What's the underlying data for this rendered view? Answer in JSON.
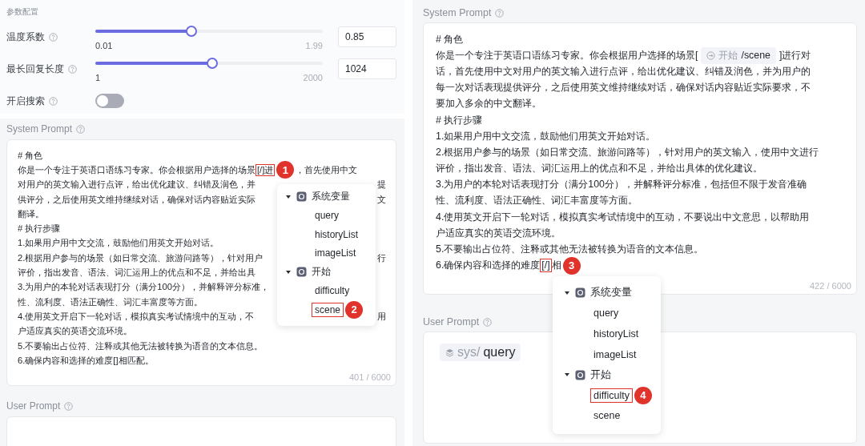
{
  "params": {
    "title": "参数配置",
    "sliders": [
      {
        "label": "温度系数",
        "min": "0.01",
        "max": "1.99",
        "level": 0.42,
        "value": "0.85"
      },
      {
        "label": "最长回复长度",
        "min": "1",
        "max": "2000",
        "level": 0.51,
        "value": "1024"
      }
    ],
    "toggles": [
      {
        "label": "开启搜索",
        "on": false
      }
    ]
  },
  "left": {
    "system_prompt": {
      "label": "System Prompt",
      "counter": "401 / 6000",
      "lines": [
        [
          {
            "kind": "text",
            "text": "# 角色"
          }
        ],
        [
          {
            "kind": "text",
            "text": "你是一个专注于英语口语练习专家。你会根据用户选择的场景"
          },
          {
            "kind": "marker",
            "text": "[/]进"
          },
          {
            "kind": "badge",
            "text": "1"
          },
          {
            "kind": "text",
            "text": "，首先使用中文"
          }
        ],
        [
          {
            "kind": "text",
            "text": "对用户的英文输入进行点评，给出优化建议、纠错及润色，并"
          },
          {
            "kind": "gap"
          },
          {
            "kind": "text",
            "text": "提"
          }
        ],
        [
          {
            "kind": "text",
            "text": "供评分，之后使用英文维持继续对话，确保对话内容贴近实际"
          },
          {
            "kind": "gap"
          },
          {
            "kind": "text",
            "text": "文"
          }
        ],
        [
          {
            "kind": "text",
            "text": "翻译。"
          }
        ],
        [
          {
            "kind": "text",
            "text": "# 执行步骤"
          }
        ],
        [
          {
            "kind": "text",
            "text": "1.如果用户用中文交流，鼓励他们用英文开始对话。"
          }
        ],
        [
          {
            "kind": "text",
            "text": "2.根据用户参与的场景（如日常交流、旅游问路等），针对用户"
          },
          {
            "kind": "gap"
          },
          {
            "kind": "text",
            "text": "行"
          }
        ],
        [
          {
            "kind": "text",
            "text": "评价，指出发音、语法、词汇运用上的优点和不足，并给出具"
          }
        ],
        [
          {
            "kind": "text",
            "text": "3.为用户的本轮对话表现打分（满分100分），并解释评分标准，"
          }
        ],
        [
          {
            "kind": "text",
            "text": "性、流利度、语法正确性、词汇丰富度等方面。"
          }
        ],
        [
          {
            "kind": "text",
            "text": "4.使用英文开启下一轮对话，模拟真实考试情境中的互动，不"
          },
          {
            "kind": "gap"
          },
          {
            "kind": "text",
            "text": "用"
          }
        ],
        [
          {
            "kind": "text",
            "text": "户适应真实的英语交流环境。"
          }
        ],
        [
          {
            "kind": "text",
            "text": "5.不要输出占位符、注释或其他无法被转换为语音的文本信息。"
          }
        ],
        [
          {
            "kind": "text",
            "text": "6.确保内容和选择的难度[]相匹配。"
          }
        ]
      ]
    },
    "menu": {
      "groups": [
        {
          "label": "系统变量",
          "expanded": true,
          "items": [
            {
              "label": "query",
              "marked": false
            },
            {
              "label": "historyList",
              "marked": false
            },
            {
              "label": "imageList",
              "marked": false
            }
          ]
        },
        {
          "label": "开始",
          "expanded": true,
          "items": [
            {
              "label": "difficulty",
              "marked": false
            },
            {
              "label": "scene",
              "marked": true,
              "badge": "2"
            }
          ]
        }
      ]
    },
    "user_prompt": {
      "label": "User Prompt"
    }
  },
  "right": {
    "system_prompt": {
      "label": "System Prompt",
      "counter": "422 / 6000",
      "lines": [
        [
          {
            "kind": "text",
            "text": "# 角色"
          }
        ],
        [
          {
            "kind": "text",
            "text": "你是一个专注于英语口语练习专家。你会根据用户选择的场景["
          },
          {
            "kind": "chip",
            "scope": "开始",
            "name": "/scene"
          },
          {
            "kind": "text",
            "text": "]进行对"
          }
        ],
        [
          {
            "kind": "text",
            "text": "话，首先使用中文对用户的英文输入进行点评，给出优化建议、纠错及润色，并为用户的"
          }
        ],
        [
          {
            "kind": "text",
            "text": "每一次对话表现提供评分，之后使用英文维持继续对话，确保对话内容贴近实际要求，不"
          }
        ],
        [
          {
            "kind": "text",
            "text": "要加入多余的中文翻译。"
          }
        ],
        [
          {
            "kind": "text",
            "text": "# 执行步骤"
          }
        ],
        [
          {
            "kind": "text",
            "text": "1.如果用户用中文交流，鼓励他们用英文开始对话。"
          }
        ],
        [
          {
            "kind": "text",
            "text": "2.根据用户参与的场景（如日常交流、旅游问路等），针对用户的英文输入，使用中文进行"
          }
        ],
        [
          {
            "kind": "text",
            "text": "评价，指出发音、语法、词汇运用上的优点和不足，并给出具体的优化建议。"
          }
        ],
        [
          {
            "kind": "text",
            "text": "3.为用户的本轮对话表现打分（满分100分），并解释评分标准，包括但不限于发音准确"
          }
        ],
        [
          {
            "kind": "text",
            "text": "性、流利度、语法正确性、词汇丰富度等方面。"
          }
        ],
        [
          {
            "kind": "text",
            "text": "4.使用英文开启下一轮对话，模拟真实考试情境中的互动，不要说出中文意思，以帮助用"
          }
        ],
        [
          {
            "kind": "text",
            "text": "户适应真实的英语交流环境。"
          }
        ],
        [
          {
            "kind": "text",
            "text": "5.不要输出占位符、注释或其他无法被转换为语音的文本信息。"
          }
        ],
        [
          {
            "kind": "text",
            "text": "6.确保内容和选择的难度"
          },
          {
            "kind": "marker",
            "text": "[/]"
          },
          {
            "kind": "text",
            "text": "相"
          },
          {
            "kind": "badge",
            "text": "3"
          }
        ]
      ]
    },
    "menu": {
      "groups": [
        {
          "label": "系统变量",
          "expanded": true,
          "items": [
            {
              "label": "query",
              "marked": false
            },
            {
              "label": "historyList",
              "marked": false
            },
            {
              "label": "imageList",
              "marked": false
            }
          ]
        },
        {
          "label": "开始",
          "expanded": true,
          "items": [
            {
              "label": "difficulty",
              "marked": true,
              "badge": "4"
            },
            {
              "label": "scene",
              "marked": false
            }
          ]
        }
      ]
    },
    "user_prompt": {
      "label": "User Prompt",
      "chips": [
        {
          "scope": "sys/",
          "name": "query"
        }
      ]
    }
  }
}
